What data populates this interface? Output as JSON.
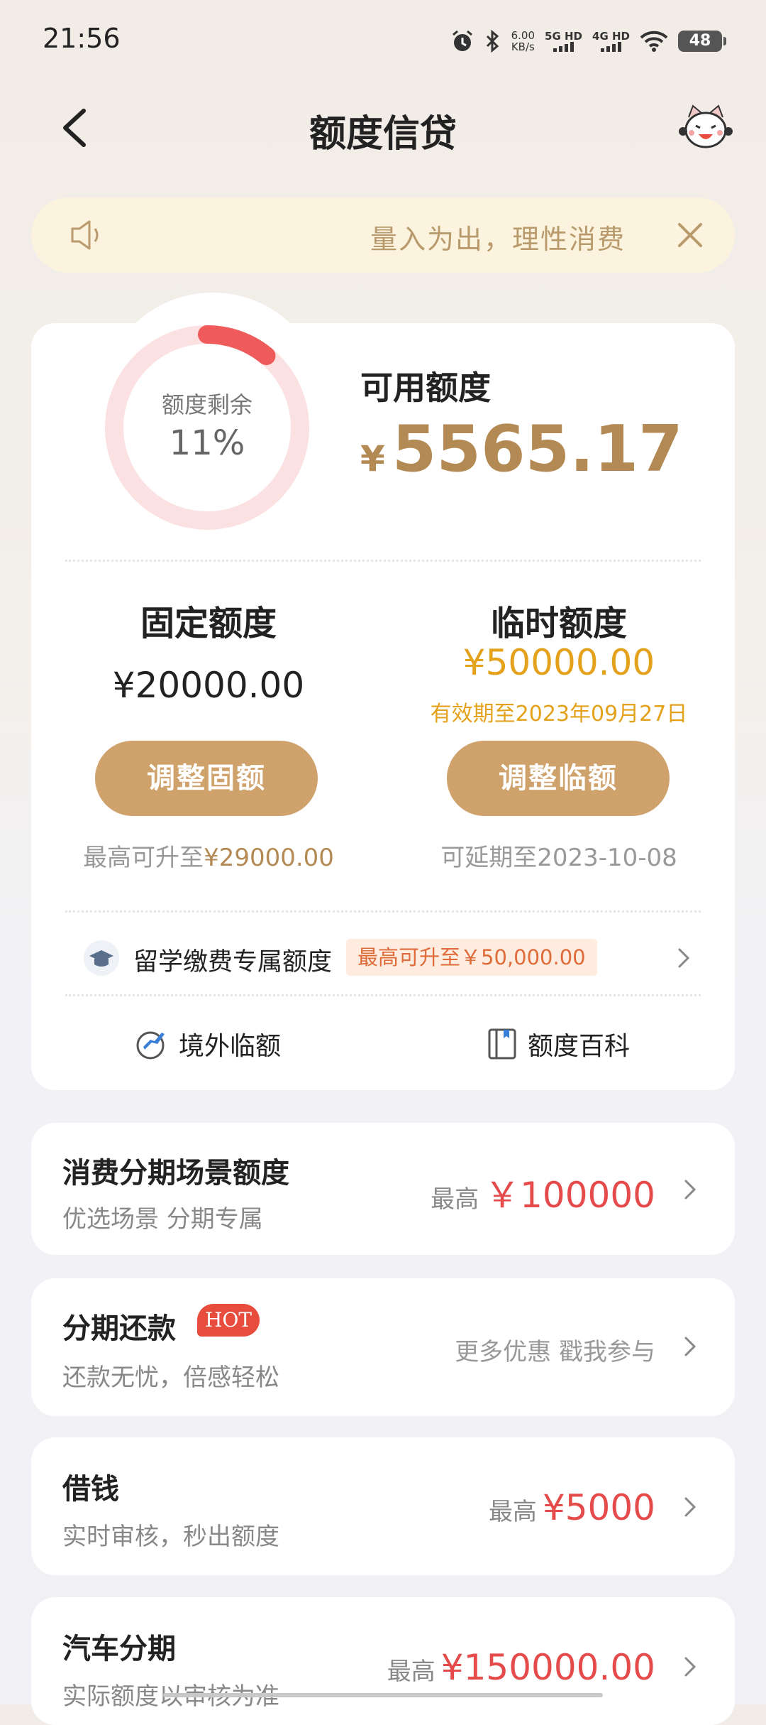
{
  "status_bar": {
    "time": "21:56",
    "net_speed_value": "6.00",
    "net_speed_unit": "KB/s",
    "sim1_label": "5G HD",
    "sim2_label": "4G HD",
    "battery": "48"
  },
  "nav": {
    "title": "额度信贷"
  },
  "notice": {
    "text": "量入为出，理性消费"
  },
  "credit": {
    "ring_label": "额度剩余",
    "ring_percent": "11%",
    "ring_fraction": 0.11,
    "available_label": "可用额度",
    "currency_symbol": "¥",
    "available_amount": "5565.17",
    "fixed": {
      "title": "固定额度",
      "amount": "¥20000.00",
      "button": "调整固额",
      "hint_prefix": "最高可升至",
      "hint_value": "¥29000.00"
    },
    "temporary": {
      "title": "临时额度",
      "amount": "¥50000.00",
      "expiry": "有效期至2023年09月27日",
      "button": "调整临额",
      "hint": "可延期至2023-10-08"
    },
    "study": {
      "label": "留学缴费专属额度",
      "tag": "最高可升至￥50,000.00"
    },
    "links": {
      "overseas": "境外临额",
      "encyclopedia": "额度百科"
    }
  },
  "products": [
    {
      "title": "消费分期场景额度",
      "subtitle": "优选场景 分期专属",
      "prefix": "最高",
      "value": "￥100000"
    },
    {
      "title": "分期还款",
      "badge": "HOT",
      "subtitle": "还款无忧，倍感轻松",
      "cta": "更多优惠 戳我参与"
    },
    {
      "title": "借钱",
      "subtitle": "实时审核，秒出额度",
      "prefix": "最高",
      "value": "¥5000"
    },
    {
      "title": "汽车分期",
      "subtitle": "实际额度以审核为准",
      "prefix": "最高",
      "value": "¥150000.00"
    }
  ],
  "colors": {
    "gold": "#cfa26c",
    "gold_text": "#b48a54",
    "amber": "#e4a21c",
    "red": "#e54b4b",
    "ring_track": "#fbe1e1",
    "ring_arc": "#ef5a5a"
  }
}
